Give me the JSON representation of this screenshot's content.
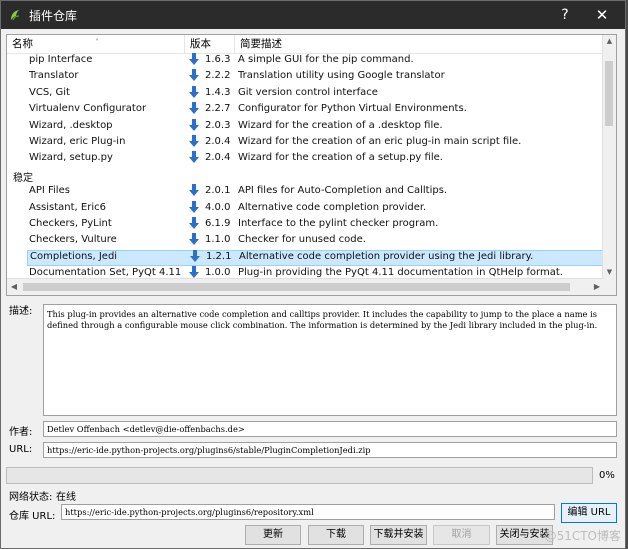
{
  "window": {
    "title": "插件仓库",
    "help_glyph": "?",
    "close_glyph": "✕"
  },
  "table": {
    "columns": [
      "名称",
      "版本",
      "简要描述"
    ],
    "rows": [
      {
        "type": "item",
        "name": "pip Interface",
        "version": "1.6.3",
        "desc": "A simple GUI for the pip command."
      },
      {
        "type": "item",
        "name": "Translator",
        "version": "2.2.2",
        "desc": "Translation utility using Google translator"
      },
      {
        "type": "item",
        "name": "VCS, Git",
        "version": "1.4.3",
        "desc": "Git version control interface"
      },
      {
        "type": "item",
        "name": "Virtualenv Configurator",
        "version": "2.2.7",
        "desc": "Configurator for Python Virtual Environments."
      },
      {
        "type": "item",
        "name": "Wizard, .desktop",
        "version": "2.0.3",
        "desc": "Wizard for the creation of a .desktop file."
      },
      {
        "type": "item",
        "name": "Wizard, eric Plug-in",
        "version": "2.0.4",
        "desc": "Wizard for the creation of an eric plug-in main script file."
      },
      {
        "type": "item",
        "name": "Wizard, setup.py",
        "version": "2.0.4",
        "desc": "Wizard for the creation of a setup.py file."
      },
      {
        "type": "group",
        "name": "稳定"
      },
      {
        "type": "item",
        "name": "API Files",
        "version": "2.0.1",
        "desc": "API files for Auto-Completion and Calltips."
      },
      {
        "type": "item",
        "name": "Assistant, Eric6",
        "version": "4.0.0",
        "desc": "Alternative code completion provider."
      },
      {
        "type": "item",
        "name": "Checkers, PyLint",
        "version": "6.1.9",
        "desc": "Interface to the pylint checker program."
      },
      {
        "type": "item",
        "name": "Checkers, Vulture",
        "version": "1.1.0",
        "desc": "Checker for unused code."
      },
      {
        "type": "item",
        "name": "Completions, Jedi",
        "version": "1.2.1",
        "desc": "Alternative code completion provider using the Jedi library.",
        "selected": true
      },
      {
        "type": "item",
        "name": "Documentation Set, PyQt 4.11",
        "version": "1.0.0",
        "desc": "Plug-in providing the PyQt 4.11 documentation in QtHelp format."
      }
    ]
  },
  "details": {
    "description_label": "描述:",
    "description": "This plug-in provides an alternative code completion and calltips provider. It includes the capability to jump to the place a name is defined through a configurable mouse click combination. The information is determined by the Jedi library included in the plug-in.",
    "author_label": "作者:",
    "author": "Detlev Offenbach <detlev@die-offenbachs.de>",
    "url_label": "URL:",
    "url": "https://eric-ide.python-projects.org/plugins6/stable/PluginCompletionJedi.zip"
  },
  "progress": {
    "percent_text": "0%",
    "value": 0
  },
  "network": {
    "status_label": "网络状态:",
    "status_value": "在线"
  },
  "repository": {
    "label": "仓库 URL:",
    "url": "https://eric-ide.python-projects.org/plugins6/repository.xml",
    "edit_button": "编辑 URL"
  },
  "buttons": {
    "refresh": "更新",
    "download": "下载",
    "download_install": "下载并安装",
    "cancel": "取消",
    "close_install": "关闭与安装"
  },
  "watermark": "@51CTO博客",
  "colors": {
    "update_arrow": "#2a6fc9",
    "selection": "#cce8ff",
    "titlebar": "#2b2b2b"
  }
}
